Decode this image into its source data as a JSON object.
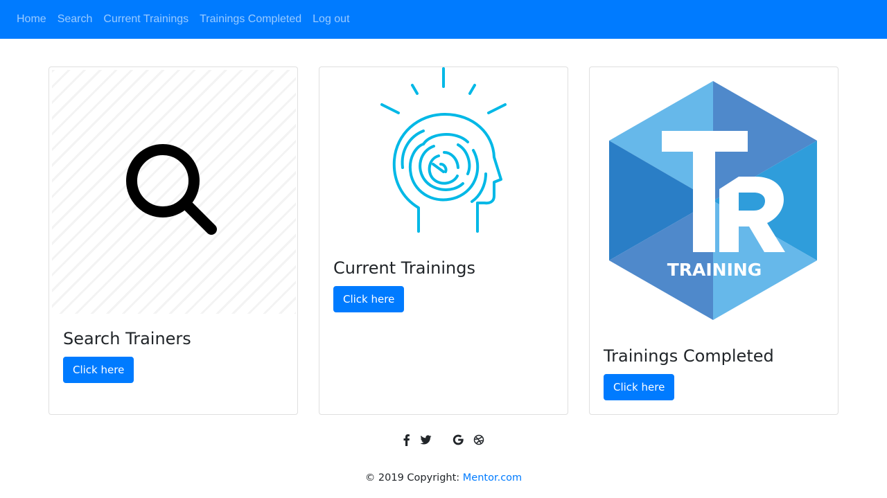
{
  "nav": {
    "items": [
      {
        "label": "Home"
      },
      {
        "label": "Search"
      },
      {
        "label": "Current Trainings"
      },
      {
        "label": "Trainings Completed"
      },
      {
        "label": "Log out"
      }
    ]
  },
  "cards": [
    {
      "title": "Search Trainers",
      "button": "Click here",
      "image_icon": "magnifier-icon"
    },
    {
      "title": "Current Trainings",
      "button": "Click here",
      "image_icon": "brain-maze-head-icon"
    },
    {
      "title": "Trainings Completed",
      "button": "Click here",
      "image_icon": "tr-training-logo",
      "logo_letters": "TR",
      "logo_text": "TRAINING"
    }
  ],
  "social": [
    "facebook-icon",
    "twitter-icon",
    "google-icon",
    "dribbble-icon"
  ],
  "footer": {
    "copyright": "© 2019 Copyright: ",
    "link_text": "Mentor.com"
  },
  "colors": {
    "primary": "#007bff",
    "head_icon": "#00b8e6",
    "hex_light": "#5fb3e8",
    "hex_dark": "#2f7fc8"
  }
}
